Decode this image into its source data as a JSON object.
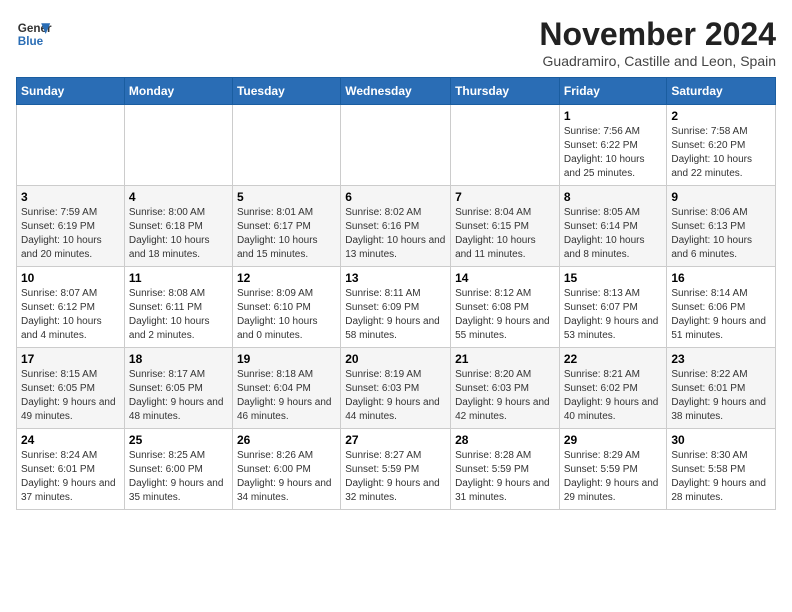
{
  "logo": {
    "line1": "General",
    "line2": "Blue"
  },
  "title": "November 2024",
  "location": "Guadramiro, Castille and Leon, Spain",
  "days_header": [
    "Sunday",
    "Monday",
    "Tuesday",
    "Wednesday",
    "Thursday",
    "Friday",
    "Saturday"
  ],
  "weeks": [
    [
      {
        "day": "",
        "info": ""
      },
      {
        "day": "",
        "info": ""
      },
      {
        "day": "",
        "info": ""
      },
      {
        "day": "",
        "info": ""
      },
      {
        "day": "",
        "info": ""
      },
      {
        "day": "1",
        "info": "Sunrise: 7:56 AM\nSunset: 6:22 PM\nDaylight: 10 hours and 25 minutes."
      },
      {
        "day": "2",
        "info": "Sunrise: 7:58 AM\nSunset: 6:20 PM\nDaylight: 10 hours and 22 minutes."
      }
    ],
    [
      {
        "day": "3",
        "info": "Sunrise: 7:59 AM\nSunset: 6:19 PM\nDaylight: 10 hours and 20 minutes."
      },
      {
        "day": "4",
        "info": "Sunrise: 8:00 AM\nSunset: 6:18 PM\nDaylight: 10 hours and 18 minutes."
      },
      {
        "day": "5",
        "info": "Sunrise: 8:01 AM\nSunset: 6:17 PM\nDaylight: 10 hours and 15 minutes."
      },
      {
        "day": "6",
        "info": "Sunrise: 8:02 AM\nSunset: 6:16 PM\nDaylight: 10 hours and 13 minutes."
      },
      {
        "day": "7",
        "info": "Sunrise: 8:04 AM\nSunset: 6:15 PM\nDaylight: 10 hours and 11 minutes."
      },
      {
        "day": "8",
        "info": "Sunrise: 8:05 AM\nSunset: 6:14 PM\nDaylight: 10 hours and 8 minutes."
      },
      {
        "day": "9",
        "info": "Sunrise: 8:06 AM\nSunset: 6:13 PM\nDaylight: 10 hours and 6 minutes."
      }
    ],
    [
      {
        "day": "10",
        "info": "Sunrise: 8:07 AM\nSunset: 6:12 PM\nDaylight: 10 hours and 4 minutes."
      },
      {
        "day": "11",
        "info": "Sunrise: 8:08 AM\nSunset: 6:11 PM\nDaylight: 10 hours and 2 minutes."
      },
      {
        "day": "12",
        "info": "Sunrise: 8:09 AM\nSunset: 6:10 PM\nDaylight: 10 hours and 0 minutes."
      },
      {
        "day": "13",
        "info": "Sunrise: 8:11 AM\nSunset: 6:09 PM\nDaylight: 9 hours and 58 minutes."
      },
      {
        "day": "14",
        "info": "Sunrise: 8:12 AM\nSunset: 6:08 PM\nDaylight: 9 hours and 55 minutes."
      },
      {
        "day": "15",
        "info": "Sunrise: 8:13 AM\nSunset: 6:07 PM\nDaylight: 9 hours and 53 minutes."
      },
      {
        "day": "16",
        "info": "Sunrise: 8:14 AM\nSunset: 6:06 PM\nDaylight: 9 hours and 51 minutes."
      }
    ],
    [
      {
        "day": "17",
        "info": "Sunrise: 8:15 AM\nSunset: 6:05 PM\nDaylight: 9 hours and 49 minutes."
      },
      {
        "day": "18",
        "info": "Sunrise: 8:17 AM\nSunset: 6:05 PM\nDaylight: 9 hours and 48 minutes."
      },
      {
        "day": "19",
        "info": "Sunrise: 8:18 AM\nSunset: 6:04 PM\nDaylight: 9 hours and 46 minutes."
      },
      {
        "day": "20",
        "info": "Sunrise: 8:19 AM\nSunset: 6:03 PM\nDaylight: 9 hours and 44 minutes."
      },
      {
        "day": "21",
        "info": "Sunrise: 8:20 AM\nSunset: 6:03 PM\nDaylight: 9 hours and 42 minutes."
      },
      {
        "day": "22",
        "info": "Sunrise: 8:21 AM\nSunset: 6:02 PM\nDaylight: 9 hours and 40 minutes."
      },
      {
        "day": "23",
        "info": "Sunrise: 8:22 AM\nSunset: 6:01 PM\nDaylight: 9 hours and 38 minutes."
      }
    ],
    [
      {
        "day": "24",
        "info": "Sunrise: 8:24 AM\nSunset: 6:01 PM\nDaylight: 9 hours and 37 minutes."
      },
      {
        "day": "25",
        "info": "Sunrise: 8:25 AM\nSunset: 6:00 PM\nDaylight: 9 hours and 35 minutes."
      },
      {
        "day": "26",
        "info": "Sunrise: 8:26 AM\nSunset: 6:00 PM\nDaylight: 9 hours and 34 minutes."
      },
      {
        "day": "27",
        "info": "Sunrise: 8:27 AM\nSunset: 5:59 PM\nDaylight: 9 hours and 32 minutes."
      },
      {
        "day": "28",
        "info": "Sunrise: 8:28 AM\nSunset: 5:59 PM\nDaylight: 9 hours and 31 minutes."
      },
      {
        "day": "29",
        "info": "Sunrise: 8:29 AM\nSunset: 5:59 PM\nDaylight: 9 hours and 29 minutes."
      },
      {
        "day": "30",
        "info": "Sunrise: 8:30 AM\nSunset: 5:58 PM\nDaylight: 9 hours and 28 minutes."
      }
    ]
  ]
}
